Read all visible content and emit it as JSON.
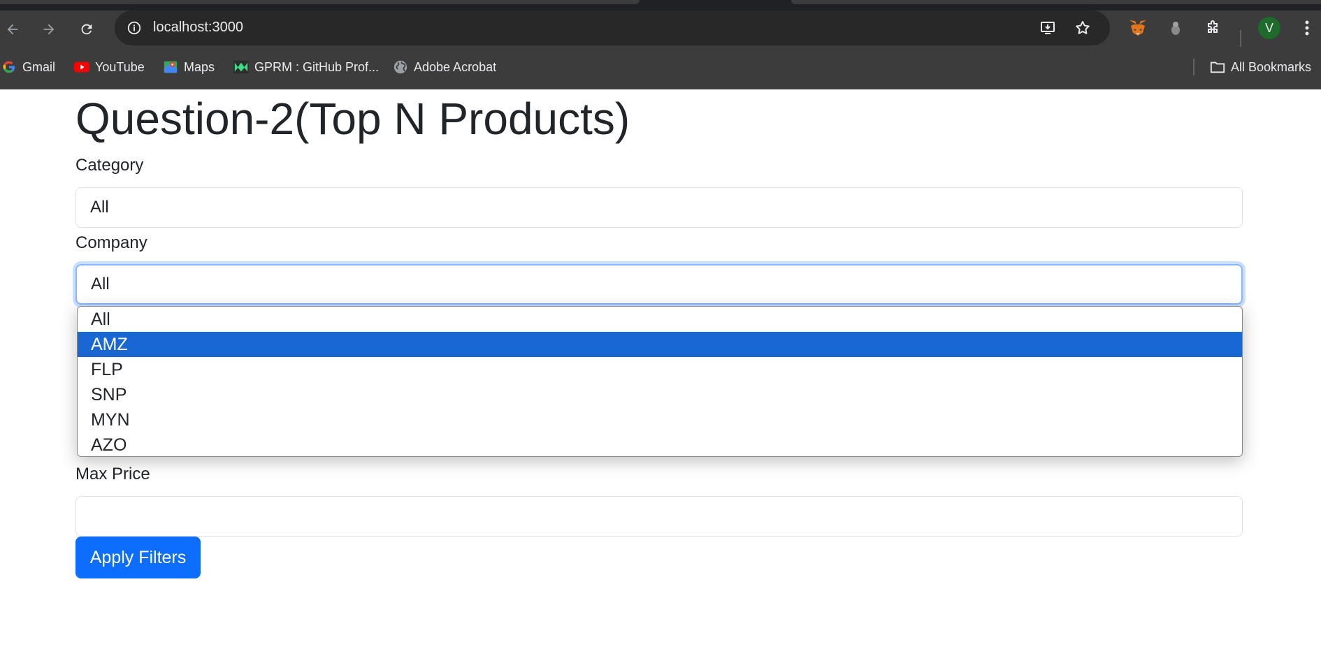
{
  "browser": {
    "url": "localhost:3000",
    "bookmarks": [
      {
        "label": "Gmail",
        "icon": "gmail-icon"
      },
      {
        "label": "YouTube",
        "icon": "youtube-icon"
      },
      {
        "label": "Maps",
        "icon": "maps-icon"
      },
      {
        "label": "GPRM : GitHub Prof...",
        "icon": "gprm-icon"
      },
      {
        "label": "Adobe Acrobat",
        "icon": "globe-icon"
      }
    ],
    "all_bookmarks": "All Bookmarks",
    "profile_initial": "V"
  },
  "page": {
    "title": "Question-2(Top N Products)",
    "category": {
      "label": "Category",
      "value": "All"
    },
    "company": {
      "label": "Company",
      "value": "All",
      "options": [
        "All",
        "AMZ",
        "FLP",
        "SNP",
        "MYN",
        "AZO"
      ],
      "highlighted": "AMZ"
    },
    "max_price": {
      "label": "Max Price",
      "value": ""
    },
    "apply_button": "Apply Filters"
  },
  "colors": {
    "primary": "#0d6efd",
    "dropdown_highlight": "#1967d2",
    "chrome_bg": "#3c3c3c"
  }
}
